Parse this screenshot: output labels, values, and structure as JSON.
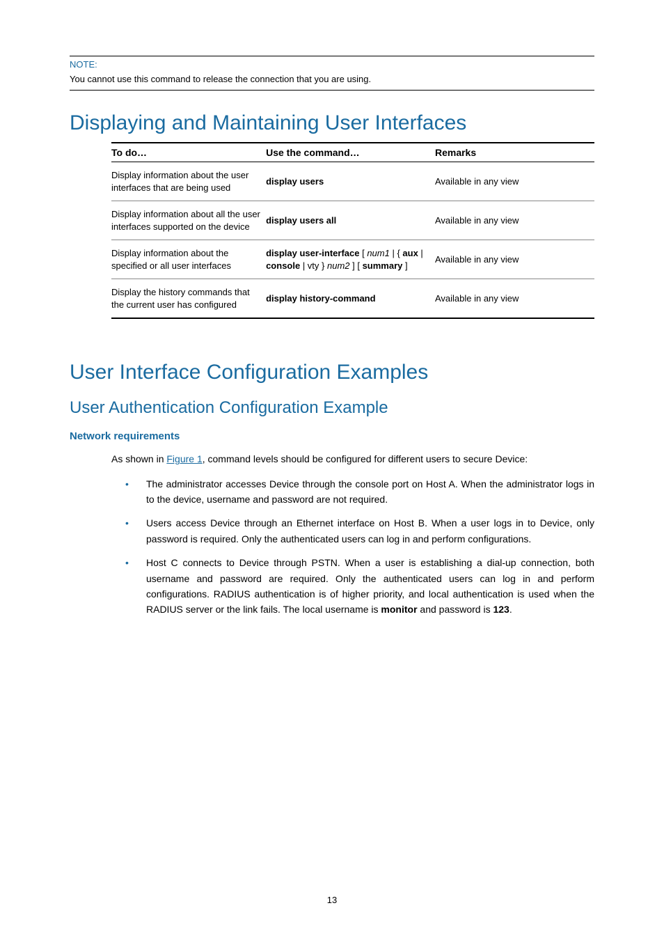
{
  "note": {
    "label": "NOTE:",
    "text": "You cannot use this command to release the connection that you are using."
  },
  "section1": {
    "title": "Displaying and Maintaining User Interfaces",
    "table": {
      "headers": [
        "To do…",
        "Use the command…",
        "Remarks"
      ],
      "rows": [
        {
          "todo": "Display information about the user interfaces that are being used",
          "cmd_bold": "display users",
          "cmd_rest": "",
          "remarks": "Available in any view"
        },
        {
          "todo": "Display information about all the user interfaces supported on the device",
          "cmd_bold": "display users all",
          "cmd_rest": "",
          "remarks": "Available in any view"
        },
        {
          "todo": "Display information about the specified or all user interfaces",
          "cmd_html": "<span class='bold'>display user-interface</span> [ <span class='italic'>num1</span> | { <span class='bold'>aux</span> | <span class='bold'>console</span> | vty } <span class='italic'>num2</span> ] [ <span class='bold'>summary</span> ]",
          "remarks": "Available in any view"
        },
        {
          "todo": "Display the history commands that the current user has configured",
          "cmd_bold": "display history-command",
          "cmd_rest": "",
          "remarks": "Available in any view"
        }
      ]
    }
  },
  "section2": {
    "title": "User Interface Configuration Examples",
    "subtitle": "User Authentication Configuration Example",
    "subsub": "Network requirements",
    "intro_prefix": "As shown in ",
    "intro_link": "Figure 1",
    "intro_suffix": ", command levels should be configured for different users to secure Device:",
    "bullets": [
      "The administrator accesses Device through the console port on Host A. When the administrator logs in to the device, username and password are not required.",
      "Users access Device through an Ethernet interface on Host B. When a user logs in to Device, only password is required. Only the authenticated users can log in and perform configurations."
    ],
    "bullet3_html": "Host C connects to Device through PSTN. When a user is establishing a dial-up connection, both username and password are required. Only the authenticated users can log in and perform configurations. RADIUS authentication is of higher priority, and local authentication is used when the RADIUS server or the link fails. The local username is <span class='bold'>monitor</span> and password is <span class='bold'>123</span>."
  },
  "page_number": "13"
}
